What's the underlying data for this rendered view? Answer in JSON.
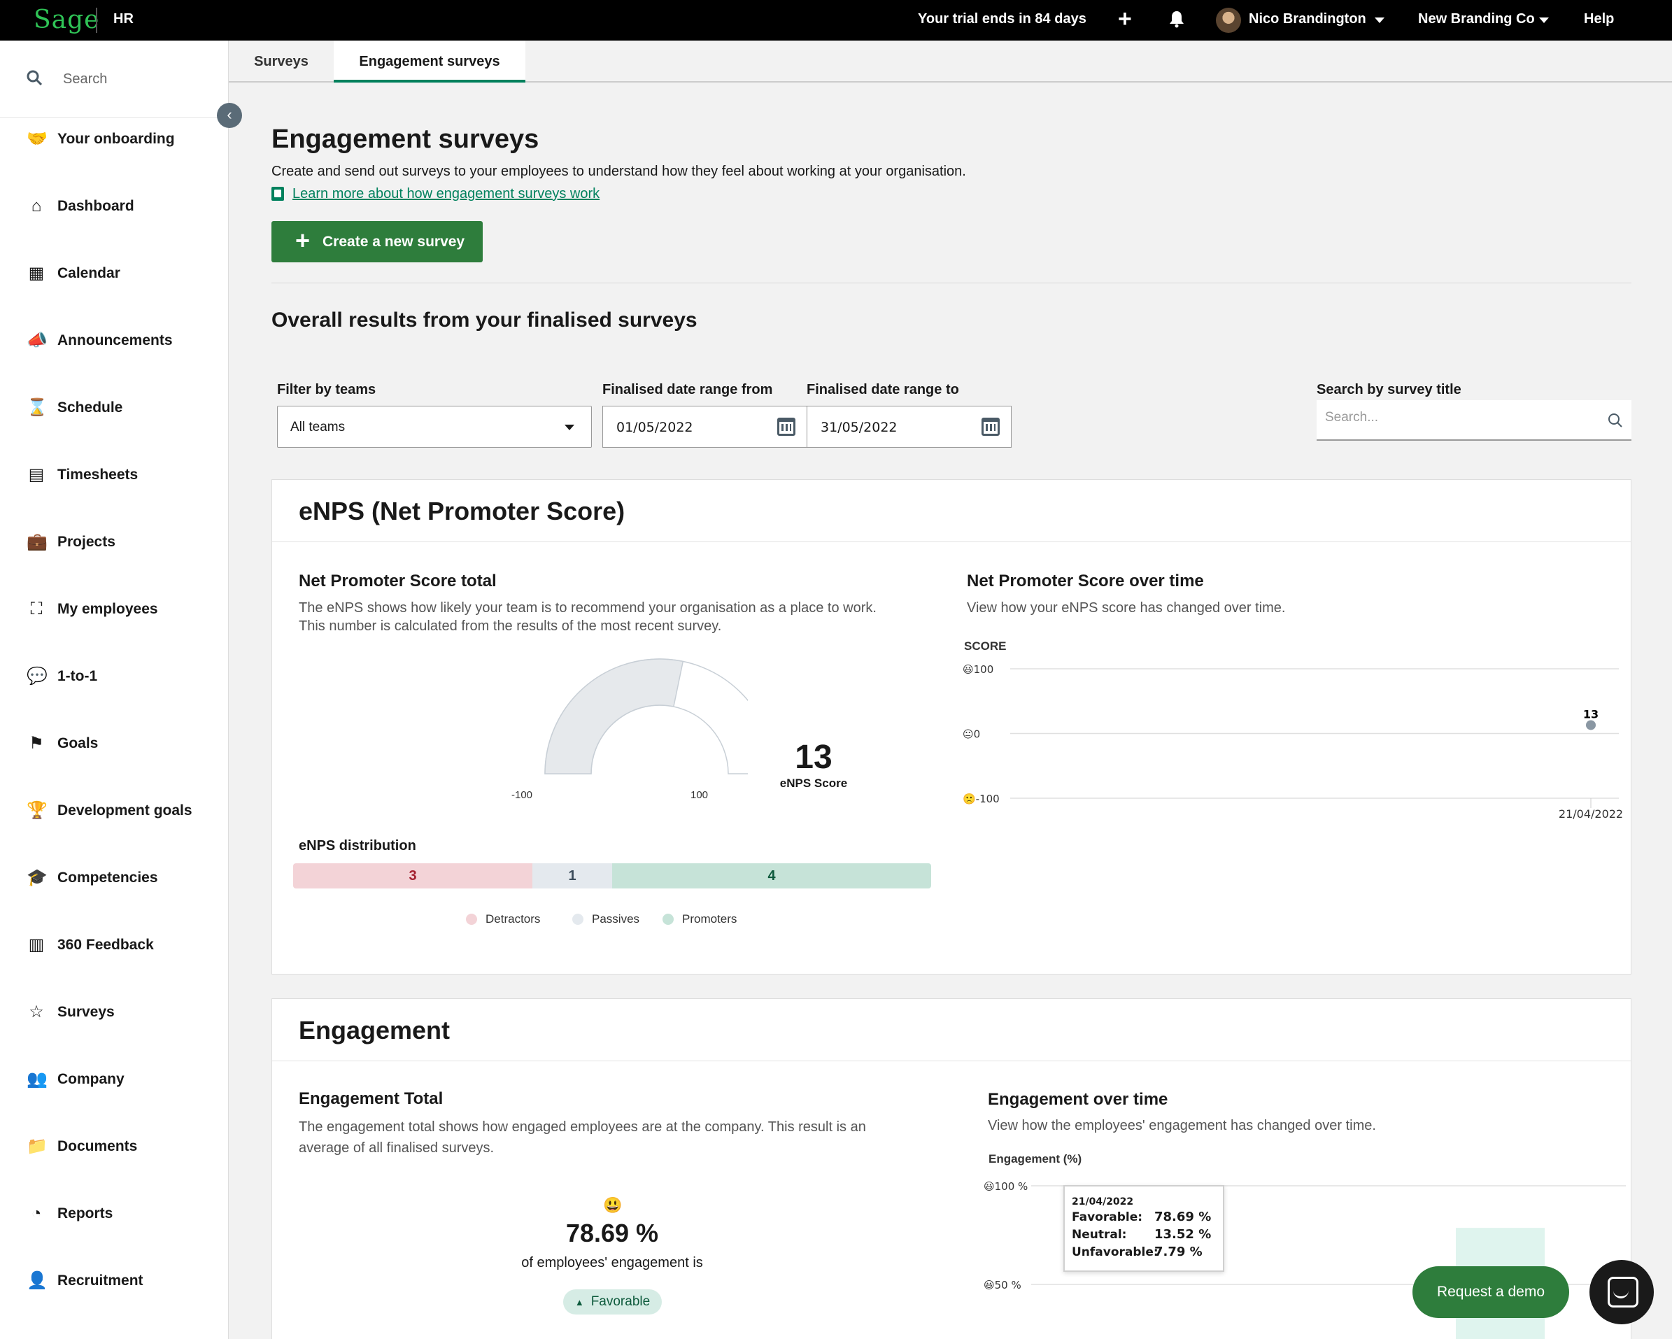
{
  "topbar": {
    "logo": "Sage",
    "product": "HR",
    "trial_text": "Your trial ends in 84 days",
    "user_name": "Nico Brandington",
    "company": "New Branding Co",
    "help": "Help"
  },
  "sidebar": {
    "search_placeholder": "Search",
    "items": [
      {
        "label": "Your onboarding",
        "icon": "handshake-icon"
      },
      {
        "label": "Dashboard",
        "icon": "home-icon"
      },
      {
        "label": "Calendar",
        "icon": "calendar-icon"
      },
      {
        "label": "Announcements",
        "icon": "megaphone-icon"
      },
      {
        "label": "Schedule",
        "icon": "hourglass-icon"
      },
      {
        "label": "Timesheets",
        "icon": "table-icon"
      },
      {
        "label": "Projects",
        "icon": "briefcase-icon"
      },
      {
        "label": "My employees",
        "icon": "org-chart-icon"
      },
      {
        "label": "1-to-1",
        "icon": "chat-bubbles-icon"
      },
      {
        "label": "Goals",
        "icon": "flag-icon"
      },
      {
        "label": "Development goals",
        "icon": "trophy-icon"
      },
      {
        "label": "Competencies",
        "icon": "graduation-cap-icon"
      },
      {
        "label": "360 Feedback",
        "icon": "clipboard-icon"
      },
      {
        "label": "Surveys",
        "icon": "star-icon"
      },
      {
        "label": "Company",
        "icon": "users-icon"
      },
      {
        "label": "Documents",
        "icon": "folder-icon"
      },
      {
        "label": "Reports",
        "icon": "pie-chart-icon"
      },
      {
        "label": "Recruitment",
        "icon": "user-plus-icon"
      }
    ]
  },
  "tabs": [
    {
      "label": "Surveys",
      "active": false
    },
    {
      "label": "Engagement surveys",
      "active": true
    }
  ],
  "header": {
    "title": "Engagement surveys",
    "description": "Create and send out surveys to your employees to understand how they feel about working at your organisation.",
    "learn_link": "Learn more about how engagement surveys work",
    "create_button": "Create a new survey"
  },
  "results": {
    "title": "Overall results from your finalised surveys",
    "filter_teams_label": "Filter by teams",
    "filter_teams_value": "All teams",
    "date_from_label": "Finalised date range from",
    "date_from_value": "01/05/2022",
    "date_to_label": "Finalised date range to",
    "date_to_value": "31/05/2022",
    "search_label": "Search by survey title",
    "search_placeholder": "Search..."
  },
  "enps": {
    "card_title": "eNPS (Net Promoter Score)",
    "total_title": "Net Promoter Score total",
    "total_desc_1": "The eNPS shows how likely your team is to recommend your organisation as a place to work.",
    "total_desc_2": "This number is calculated from the results of the most recent survey.",
    "score": "13",
    "score_caption": "eNPS Score",
    "gauge_min": "-100",
    "gauge_max": "100",
    "gauge_value": 13,
    "distribution_title": "eNPS distribution",
    "distribution": [
      {
        "label": "Detractors",
        "value": 3,
        "color": "#f3d3d7",
        "text_color": "#a3202f"
      },
      {
        "label": "Passives",
        "value": 1,
        "color": "#e4e9ee",
        "text_color": "#3b4b5a"
      },
      {
        "label": "Promoters",
        "value": 4,
        "color": "#c6e3d8",
        "text_color": "#0d5a3c"
      }
    ],
    "over_time_title": "Net Promoter Score over time",
    "over_time_desc": "View how your eNPS score has changed over time.",
    "axis_title": "SCORE"
  },
  "engagement": {
    "card_title": "Engagement",
    "total_title": "Engagement Total",
    "total_desc_1": "The engagement total shows how engaged employees are at the company. This result is an",
    "total_desc_2": "average of all finalised surveys.",
    "value": "78.69 %",
    "value_sub": "of employees' engagement is",
    "badge": "Favorable",
    "over_time_title": "Engagement over time",
    "over_time_desc": "View how the employees' engagement has changed over time.",
    "axis_title": "Engagement (%)",
    "tooltip": {
      "date": "21/04/2022",
      "rows": [
        {
          "label": "Favorable:",
          "value": "78.69 %"
        },
        {
          "label": "Neutral:",
          "value": "13.52 %"
        },
        {
          "label": "Unfavorable:",
          "value": "7.79 %"
        }
      ]
    }
  },
  "chart_data": [
    {
      "type": "scatter",
      "title": "Net Promoter Score over time",
      "ylabel": "SCORE",
      "ylim": [
        -100,
        100
      ],
      "y_ticks": [
        "100",
        "0",
        "-100"
      ],
      "x": [
        "21/04/2022"
      ],
      "series": [
        {
          "values": [
            13
          ]
        }
      ]
    },
    {
      "type": "bar",
      "title": "Engagement over time",
      "ylabel": "Engagement (%)",
      "ylim": [
        0,
        100
      ],
      "y_ticks": [
        "100 %",
        "50 %"
      ],
      "categories": [
        "21/04/2022"
      ],
      "series": [
        {
          "name": "Favorable",
          "values": [
            78.69
          ]
        }
      ]
    }
  ],
  "widgets": {
    "demo_button": "Request a demo"
  },
  "colors": {
    "brand_green": "#2e7d3c",
    "link_green": "#00815d",
    "logo_green": "#2fc356"
  }
}
